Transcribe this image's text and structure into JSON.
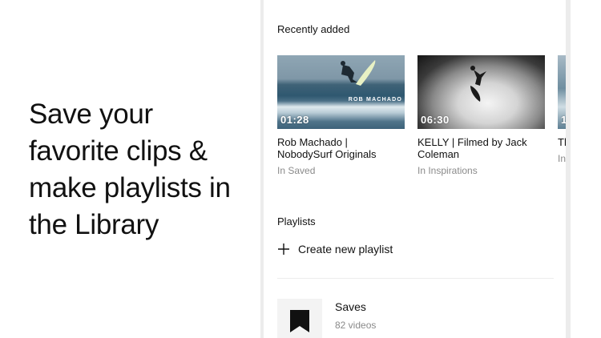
{
  "promo": {
    "headline": "Save your favorite clips & make playlists in the Library"
  },
  "library": {
    "recent_label": "Recently added",
    "recent_items": [
      {
        "title": "Rob Machado | NobodySurf Originals",
        "subtitle": "In Saved",
        "duration": "01:28",
        "thumb_text": "ROB MACHADO"
      },
      {
        "title": "KELLY | Filmed by Jack Coleman",
        "subtitle": "In Inspirations",
        "duration": "06:30"
      },
      {
        "title": "Th",
        "subtitle": "In",
        "duration": "1"
      }
    ],
    "playlists_label": "Playlists",
    "create_label": "Create new playlist",
    "playlists": [
      {
        "name": "Saves",
        "count": "82 videos",
        "icon": "bookmark-icon"
      }
    ]
  },
  "colors": {
    "text_primary": "#111111",
    "text_secondary": "#8a8a8a",
    "divider": "#ececec",
    "thumb_placeholder": "#f3f3f3"
  }
}
